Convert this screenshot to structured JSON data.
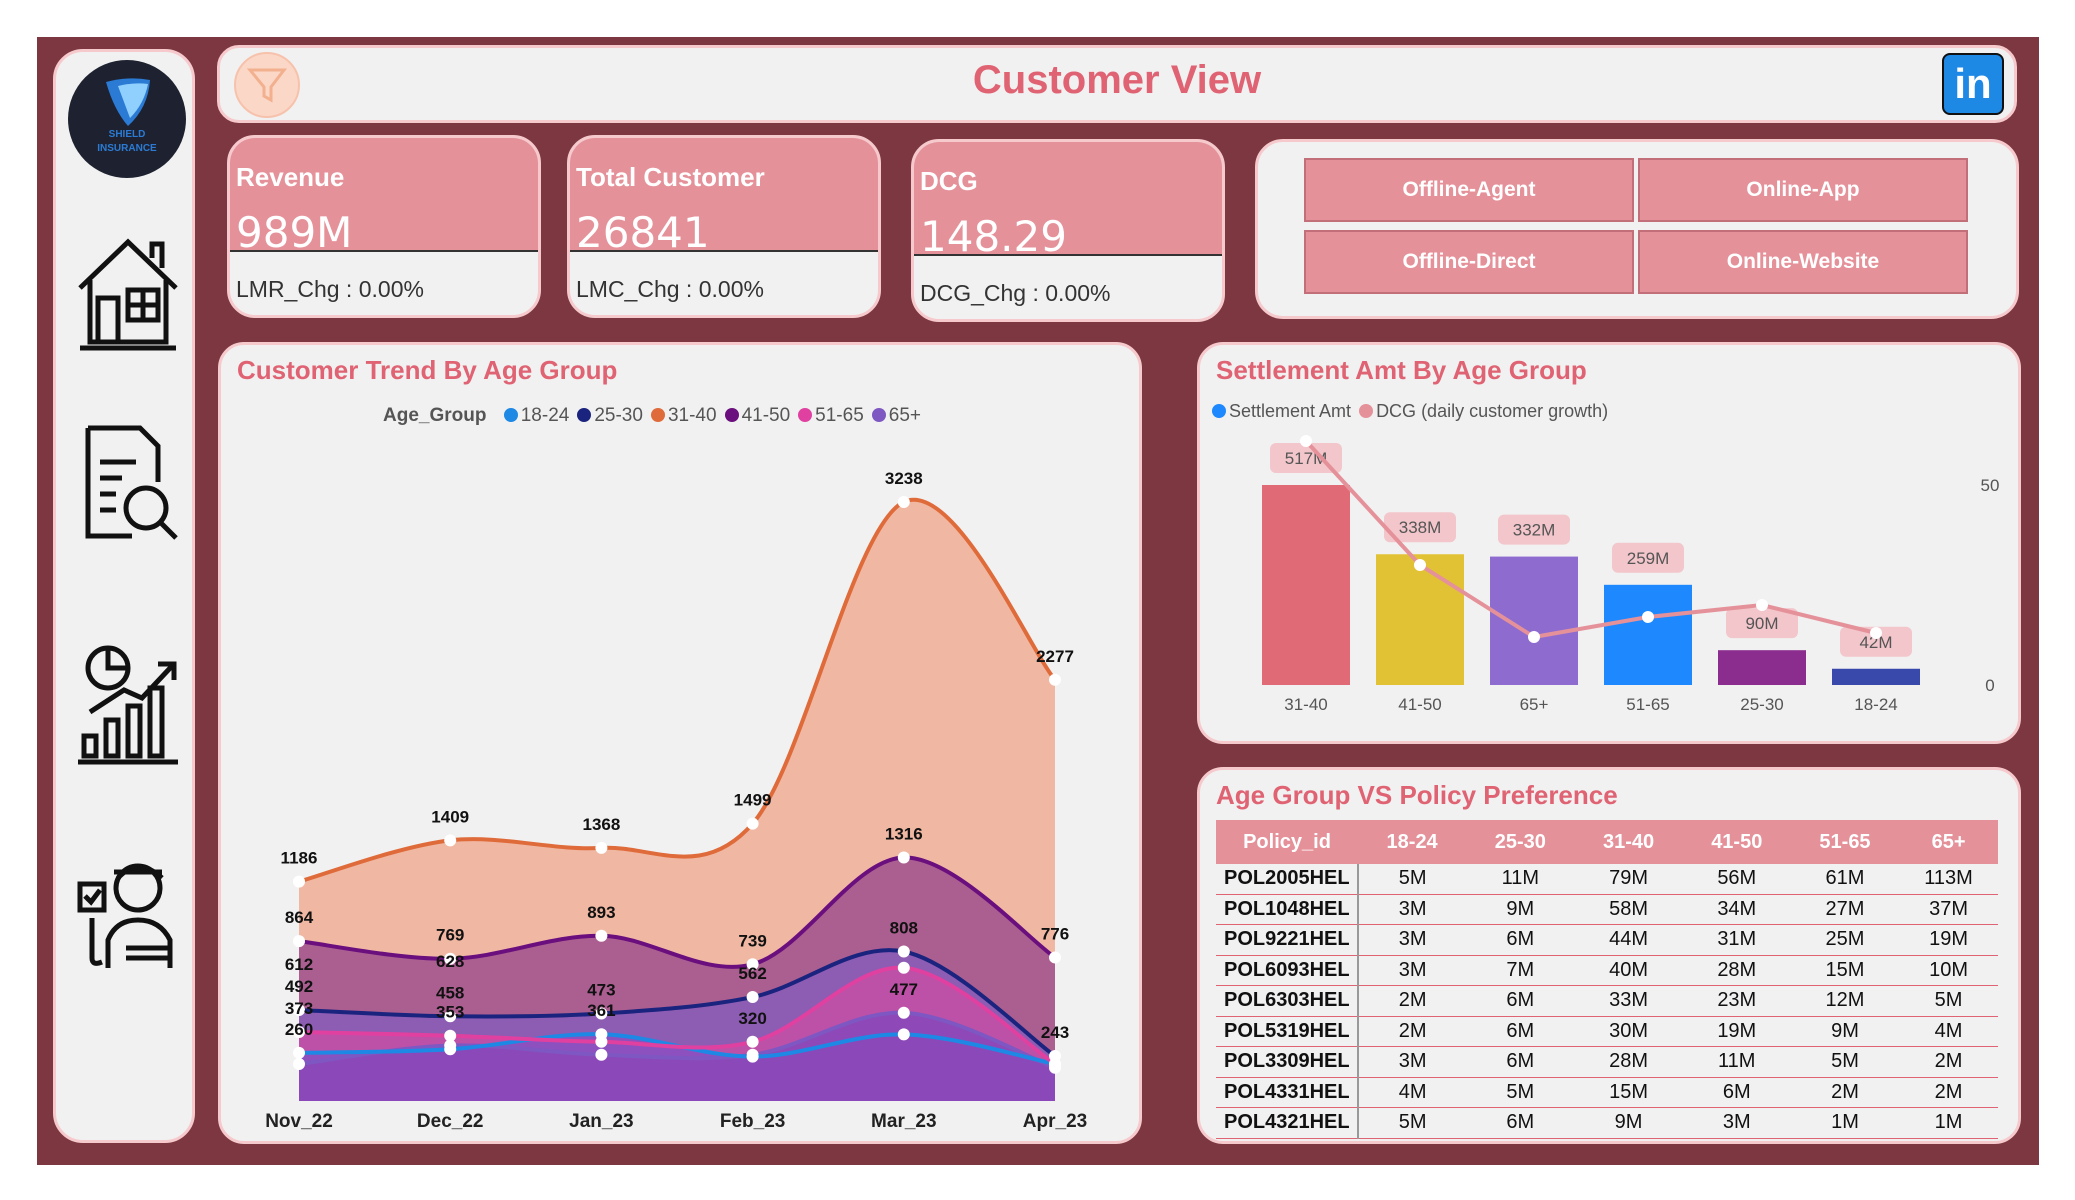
{
  "header": {
    "title": "Customer View"
  },
  "logo": {
    "line1": "SHIELD",
    "line2": "INSURANCE"
  },
  "linkedin": {
    "label": "in"
  },
  "kpis": {
    "revenue": {
      "label": "Revenue",
      "value": "989M",
      "change": "LMR_Chg : 0.00%"
    },
    "customers": {
      "label": "Total Customer",
      "value": "26841",
      "change": "LMC_Chg : 0.00%"
    },
    "dcg": {
      "label": "DCG",
      "value": "148.29",
      "change": "DCG_Chg : 0.00%"
    }
  },
  "channels": [
    "Offline-Agent",
    "Online-App",
    "Offline-Direct",
    "Online-Website"
  ],
  "trend": {
    "title": "Customer Trend By Age Group",
    "legend_title": "Age_Group"
  },
  "settlement": {
    "title": "Settlement Amt By Age Group"
  },
  "policy": {
    "title": "Age Group VS Policy Preference",
    "columns": [
      "Policy_id",
      "18-24",
      "25-30",
      "31-40",
      "41-50",
      "51-65",
      "65+"
    ],
    "rows": [
      [
        "POL2005HEL",
        "5M",
        "11M",
        "79M",
        "56M",
        "61M",
        "113M"
      ],
      [
        "POL1048HEL",
        "3M",
        "9M",
        "58M",
        "34M",
        "27M",
        "37M"
      ],
      [
        "POL9221HEL",
        "3M",
        "6M",
        "44M",
        "31M",
        "25M",
        "19M"
      ],
      [
        "POL6093HEL",
        "3M",
        "7M",
        "40M",
        "28M",
        "15M",
        "10M"
      ],
      [
        "POL6303HEL",
        "2M",
        "6M",
        "33M",
        "23M",
        "12M",
        "5M"
      ],
      [
        "POL5319HEL",
        "2M",
        "6M",
        "30M",
        "19M",
        "9M",
        "4M"
      ],
      [
        "POL3309HEL",
        "3M",
        "6M",
        "28M",
        "11M",
        "5M",
        "2M"
      ],
      [
        "POL4331HEL",
        "4M",
        "5M",
        "15M",
        "6M",
        "2M",
        "2M"
      ],
      [
        "POL4321HEL",
        "5M",
        "6M",
        "9M",
        "3M",
        "1M",
        "1M"
      ]
    ]
  },
  "colors": {
    "accent": "#e06373",
    "frame": "#7d3740",
    "card_header": "#e5919a"
  },
  "chart_data": [
    {
      "type": "area",
      "title": "Customer Trend By Age Group",
      "x": [
        "Nov_22",
        "Dec_22",
        "Jan_23",
        "Feb_23",
        "Mar_23",
        "Apr_23"
      ],
      "ylim": [
        0,
        3600
      ],
      "legend_title": "Age_Group",
      "legend_placement": "top",
      "series": [
        {
          "name": "18-24",
          "color": "#1e88e5",
          "values": [
            260,
            280,
            361,
            240,
            360,
            200
          ]
        },
        {
          "name": "25-30",
          "color": "#1a237e",
          "values": [
            492,
            458,
            473,
            562,
            808,
            243
          ]
        },
        {
          "name": "31-40",
          "color": "#e06b3a",
          "values": [
            1186,
            1409,
            1368,
            1499,
            3238,
            2277
          ]
        },
        {
          "name": "41-50",
          "color": "#6a0f7d",
          "values": [
            864,
            769,
            893,
            739,
            1316,
            776
          ]
        },
        {
          "name": "51-65",
          "color": "#e040a0",
          "values": [
            373,
            353,
            320,
            320,
            720,
            200
          ]
        },
        {
          "name": "65+",
          "color": "#7e57c2",
          "values": [
            200,
            300,
            250,
            250,
            477,
            180
          ]
        }
      ],
      "labels": [
        {
          "x": "Nov_22",
          "texts": [
            "1186",
            "864",
            "612",
            "492",
            "373",
            "260"
          ]
        },
        {
          "x": "Dec_22",
          "texts": [
            "1409",
            "769",
            "628",
            "458",
            "353"
          ]
        },
        {
          "x": "Jan_23",
          "texts": [
            "1368",
            "893",
            "473",
            "361"
          ]
        },
        {
          "x": "Feb_23",
          "texts": [
            "1499",
            "739",
            "562",
            "320"
          ]
        },
        {
          "x": "Mar_23",
          "texts": [
            "3238",
            "1316",
            "808",
            "477"
          ]
        },
        {
          "x": "Apr_23",
          "texts": [
            "2277",
            "776",
            "243"
          ]
        }
      ]
    },
    {
      "type": "bar",
      "title": "Settlement Amt By Age Group",
      "categories": [
        "31-40",
        "41-50",
        "65+",
        "51-65",
        "25-30",
        "18-24"
      ],
      "series": [
        {
          "name": "Settlement Amt",
          "color_key": "bar",
          "values": [
            517,
            338,
            332,
            259,
            90,
            42
          ],
          "labels": [
            "517M",
            "338M",
            "332M",
            "259M",
            "90M",
            "42M"
          ]
        },
        {
          "name": "DCG (daily customer growth)",
          "type": "line",
          "color": "#e5919a",
          "values": [
            61,
            30,
            12,
            17,
            20,
            13
          ]
        }
      ],
      "bar_colors": [
        "#e06a75",
        "#e2c235",
        "#8e6ccf",
        "#1e88ff",
        "#8b2d8f",
        "#3949ab"
      ],
      "y2_ticks": [
        "50",
        "0"
      ],
      "y2lim": [
        0,
        70
      ],
      "legend_placement": "top-left"
    }
  ]
}
